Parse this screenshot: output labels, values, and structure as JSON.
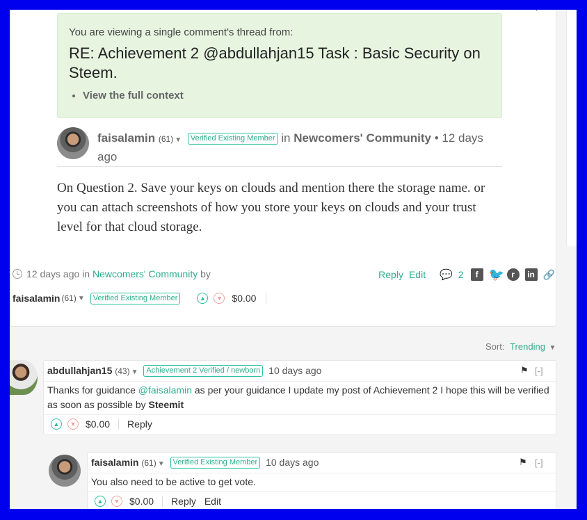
{
  "context_box": {
    "intro": "You are viewing a single comment's thread from:",
    "title": "RE: Achievement 2 @abdullahjan15 Task : Basic Security on Steem.",
    "link": "View the full context"
  },
  "post": {
    "author": "faisalamin",
    "reputation": "(61)",
    "badge": "Verified Existing Member",
    "in_word": "in",
    "community": "Newcomers' Community",
    "time": "• 12 days ago",
    "body": "On Question 2. Save your keys on clouds and mention there the storage name. or you can attach screenshots of how you store your keys on clouds and your trust level for that cloud storage.",
    "meta_time": "12 days ago in",
    "meta_community": "Newcomers' Community",
    "meta_by": "by",
    "reply_label": "Reply",
    "edit_label": "Edit",
    "comment_count": "2",
    "payout": "$0.00"
  },
  "sort": {
    "label": "Sort:",
    "value": "Trending"
  },
  "comments": [
    {
      "author": "abdullahjan15",
      "reputation": "(43)",
      "badge": "Achievement 2 Verified / newborn",
      "time": "10 days ago",
      "body_pre": "Thanks for guidance",
      "mention": "@faisalamin",
      "body_post": "as per your guidance I update my post of Achievement 2 I hope this will be verified as soon as possible by",
      "body_bold": "Steemit",
      "payout": "$0.00",
      "reply_label": "Reply",
      "collapse": "[-]"
    },
    {
      "author": "faisalamin",
      "reputation": "(61)",
      "badge": "Verified Existing Member",
      "time": "10 days ago",
      "body": "You also need to be active to get vote.",
      "payout": "$0.00",
      "reply_label": "Reply",
      "edit_label": "Edit",
      "collapse": "[-]"
    }
  ],
  "colors": {
    "accent": "#2dae8c",
    "frame": "#0000ee",
    "context_bg": "#e6f4e0"
  }
}
